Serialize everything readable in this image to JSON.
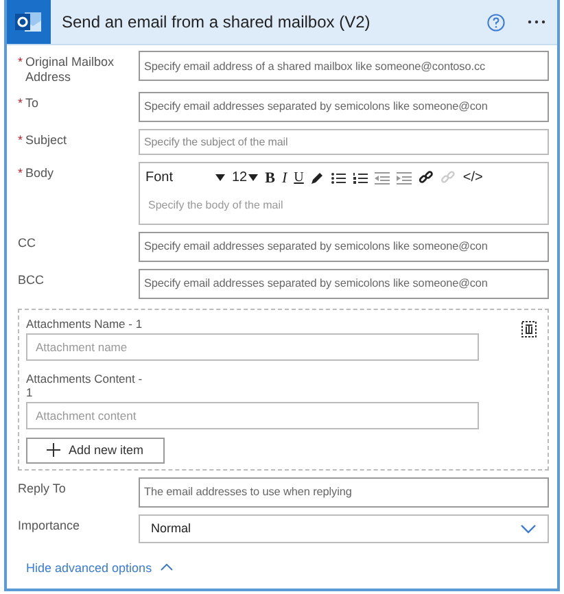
{
  "header": {
    "title": "Send an email from a shared mailbox (V2)"
  },
  "fields": [
    {
      "label": "Original Mailbox Address",
      "marker": "*",
      "kind": "text",
      "placeholder": "Specify email address of a shared mailbox like someone@contoso.cc"
    },
    {
      "label": "To",
      "marker": "*",
      "kind": "text",
      "placeholder": "Specify email addresses separated by semicolons like someone@con"
    },
    {
      "label": "Subject",
      "marker": "*",
      "kind": "small",
      "placeholder": "Specify the subject of the mail"
    },
    {
      "label": "Body",
      "marker": "*",
      "kind": "richtext",
      "placeholder": "Specify the body of the mail",
      "toolbar": {
        "font": "Font",
        "size": "12",
        "bold": "B",
        "italic": "I",
        "underline": "U",
        "code": "</>"
      }
    },
    {
      "label": "CC",
      "kind": "text",
      "placeholder": "Specify email addresses separated by semicolons like someone@con"
    },
    {
      "label": "BCC",
      "kind": "text",
      "placeholder": "Specify email addresses separated by semicolons like someone@con"
    }
  ],
  "attachments": {
    "items": [
      {
        "name_label": "Attachments Name - 1",
        "name_placeholder": "Attachment name",
        "content_label": "Attachments Content - 1",
        "content_placeholder": "Attachment content"
      }
    ],
    "add_button": "Add new item"
  },
  "advanced": [
    {
      "label": "Reply To",
      "kind": "text",
      "placeholder": "The email addresses to use when replying"
    },
    {
      "label": "Importance",
      "kind": "dropdown",
      "value": "Normal"
    }
  ],
  "toggle_link": "Hide advanced options"
}
